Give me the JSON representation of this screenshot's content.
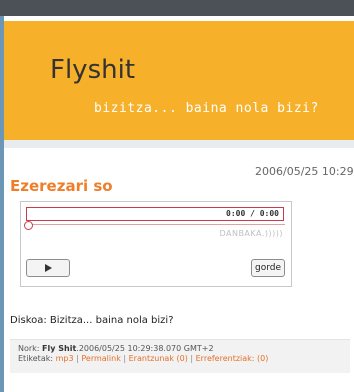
{
  "blog": {
    "title": "Flyshit",
    "tagline": "bizitza... baina nola bizi?"
  },
  "post": {
    "date": "2006/05/25 10:29",
    "title": "Ezerezari so",
    "body": "Diskoa: Bizitza... baina nola bizi?"
  },
  "player": {
    "time": "0:00 / 0:00",
    "progress": 0,
    "brand": "DANBAKA.)))))",
    "play_label": "play",
    "save_label": "gorde"
  },
  "footer": {
    "author_label": "Nork:",
    "author": "Fly Shit",
    "timestamp": ".2006/05/25 10:29:38.070 GMT+2",
    "tags_label": "Etiketak:",
    "tag": "mp3",
    "separator": "|",
    "permalink": "Permalink",
    "comments": "Erantzunak (0)",
    "references": "Erreferentziak: (0)"
  },
  "colors": {
    "background": "#6b96b6",
    "header": "#f7b02a",
    "title_accent": "#ef7e2a",
    "player_accent": "#cc3a4a",
    "link": "#e4712a"
  }
}
